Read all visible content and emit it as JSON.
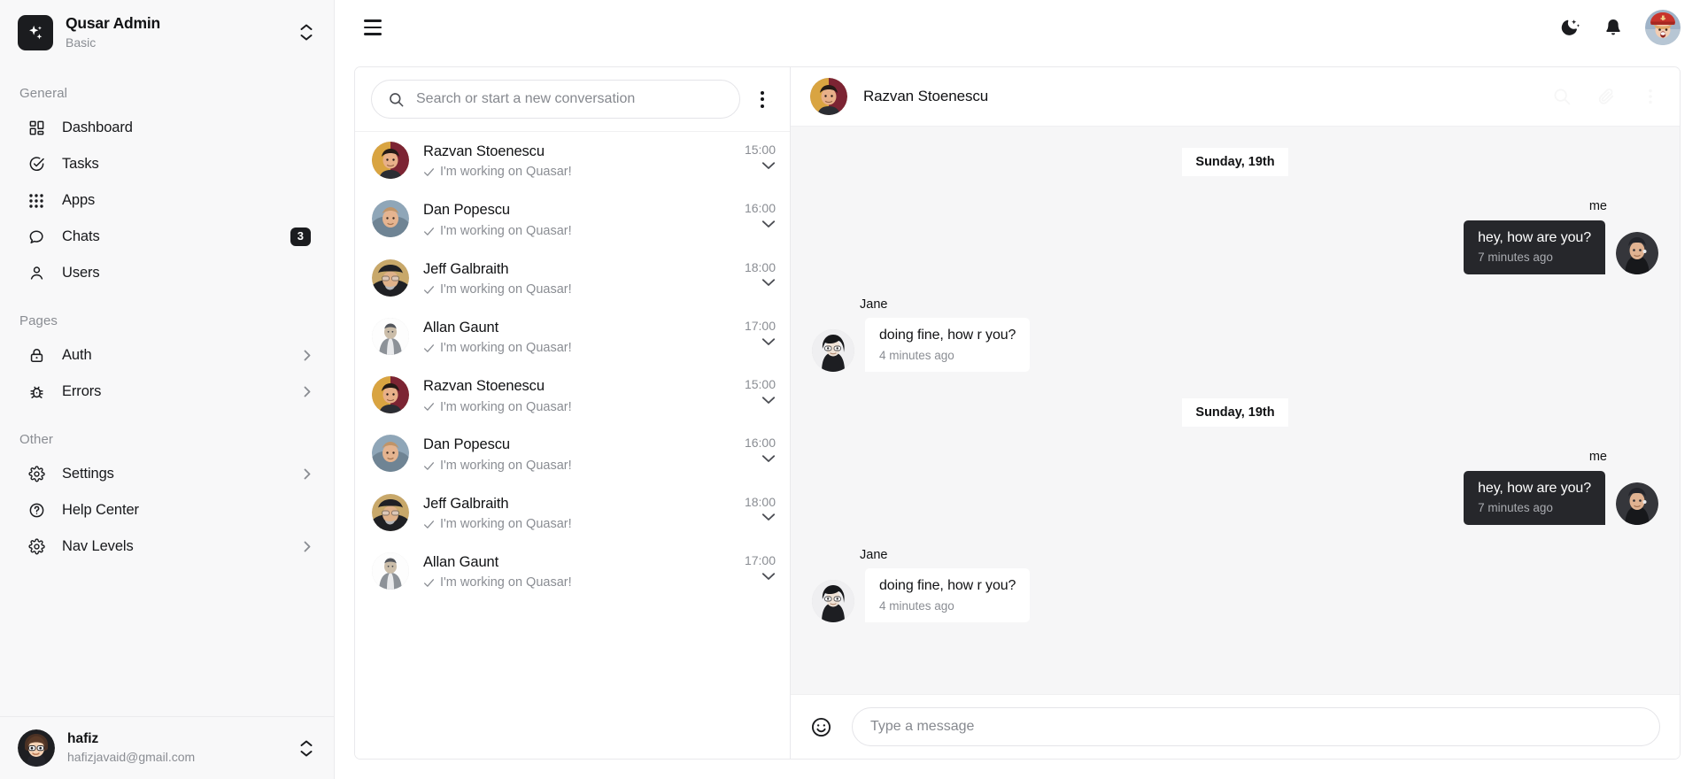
{
  "brand": {
    "logo_icon": "sparkle-icon",
    "title": "Qusar Admin",
    "subtitle": "Basic",
    "switcher_icon": "chevron-up-down-icon"
  },
  "sidebar": {
    "groups": [
      {
        "label": "General",
        "items": [
          {
            "label": "Dashboard",
            "icon": "dashboard-grid-icon",
            "badge": null,
            "expandable": false
          },
          {
            "label": "Tasks",
            "icon": "task-check-circle-icon",
            "badge": null,
            "expandable": false
          },
          {
            "label": "Apps",
            "icon": "apps-dots-grid-icon",
            "badge": null,
            "expandable": false
          },
          {
            "label": "Chats",
            "icon": "chat-bubble-icon",
            "badge": "3",
            "expandable": false
          },
          {
            "label": "Users",
            "icon": "user-person-icon",
            "badge": null,
            "expandable": false
          }
        ]
      },
      {
        "label": "Pages",
        "items": [
          {
            "label": "Auth",
            "icon": "lock-icon",
            "badge": null,
            "expandable": true
          },
          {
            "label": "Errors",
            "icon": "bug-icon",
            "badge": null,
            "expandable": true
          }
        ]
      },
      {
        "label": "Other",
        "items": [
          {
            "label": "Settings",
            "icon": "gear-icon",
            "badge": null,
            "expandable": true
          },
          {
            "label": "Help Center",
            "icon": "help-circle-icon",
            "badge": null,
            "expandable": false
          },
          {
            "label": "Nav Levels",
            "icon": "gear-icon",
            "badge": null,
            "expandable": true
          }
        ]
      }
    ],
    "footer": {
      "name": "hafiz",
      "email": "hafizjavaid@gmail.com",
      "avatar": "user-avatar-cartoon",
      "switcher_icon": "chevron-up-down-icon"
    }
  },
  "topbar": {
    "menu_icon": "hamburger-menu-icon",
    "dark_mode_icon": "moon-stars-icon",
    "notifications_icon": "bell-icon",
    "account_avatar": "account-avatar"
  },
  "conversations": {
    "search": {
      "placeholder": "Search or start a new conversation",
      "value": "",
      "icon": "search-icon"
    },
    "menu_icon": "more-vertical-icon",
    "items": [
      {
        "name": "Razvan Stoenescu",
        "snippet": "I'm working on Quasar!",
        "time": "15:00",
        "status_icon": "check-icon",
        "caret_icon": "chevron-down-icon",
        "avatar_tone": "razvan"
      },
      {
        "name": "Dan Popescu",
        "snippet": "I'm working on Quasar!",
        "time": "16:00",
        "status_icon": "check-icon",
        "caret_icon": "chevron-down-icon",
        "avatar_tone": "dan"
      },
      {
        "name": "Jeff Galbraith",
        "snippet": "I'm working on Quasar!",
        "time": "18:00",
        "status_icon": "check-icon",
        "caret_icon": "chevron-down-icon",
        "avatar_tone": "jeff"
      },
      {
        "name": "Allan Gaunt",
        "snippet": "I'm working on Quasar!",
        "time": "17:00",
        "status_icon": "check-icon",
        "caret_icon": "chevron-down-icon",
        "avatar_tone": "allan"
      },
      {
        "name": "Razvan Stoenescu",
        "snippet": "I'm working on Quasar!",
        "time": "15:00",
        "status_icon": "check-icon",
        "caret_icon": "chevron-down-icon",
        "avatar_tone": "razvan"
      },
      {
        "name": "Dan Popescu",
        "snippet": "I'm working on Quasar!",
        "time": "16:00",
        "status_icon": "check-icon",
        "caret_icon": "chevron-down-icon",
        "avatar_tone": "dan"
      },
      {
        "name": "Jeff Galbraith",
        "snippet": "I'm working on Quasar!",
        "time": "18:00",
        "status_icon": "check-icon",
        "caret_icon": "chevron-down-icon",
        "avatar_tone": "jeff"
      },
      {
        "name": "Allan Gaunt",
        "snippet": "I'm working on Quasar!",
        "time": "17:00",
        "status_icon": "check-icon",
        "caret_icon": "chevron-down-icon",
        "avatar_tone": "allan"
      }
    ]
  },
  "chat": {
    "header": {
      "title": "Razvan Stoenescu",
      "avatar": "razvan",
      "actions": [
        "search-icon",
        "attachment-icon",
        "more-vertical-icon"
      ]
    },
    "groups": [
      {
        "day": "Sunday, 19th",
        "messages": [
          {
            "side": "sent",
            "label": "me",
            "text": "hey, how are you?",
            "time": "7 minutes ago",
            "avatar": "me"
          },
          {
            "side": "received",
            "label": "Jane",
            "text": "doing fine, how r you?",
            "time": "4 minutes ago",
            "avatar": "jane"
          }
        ]
      },
      {
        "day": "Sunday, 19th",
        "messages": [
          {
            "side": "sent",
            "label": "me",
            "text": "hey, how are you?",
            "time": "7 minutes ago",
            "avatar": "me"
          },
          {
            "side": "received",
            "label": "Jane",
            "text": "doing fine, how r you?",
            "time": "4 minutes ago",
            "avatar": "jane"
          }
        ]
      }
    ],
    "composer": {
      "emoji_icon": "emoji-smiley-icon",
      "placeholder": "Type a message",
      "value": ""
    }
  },
  "colors": {
    "accent_dark": "#1b1c1f",
    "sidebar_bg": "#f8f8f9",
    "chat_bg": "#f6f6f7",
    "muted_text": "#8a8d93",
    "bubble_sent": "#26272b"
  }
}
